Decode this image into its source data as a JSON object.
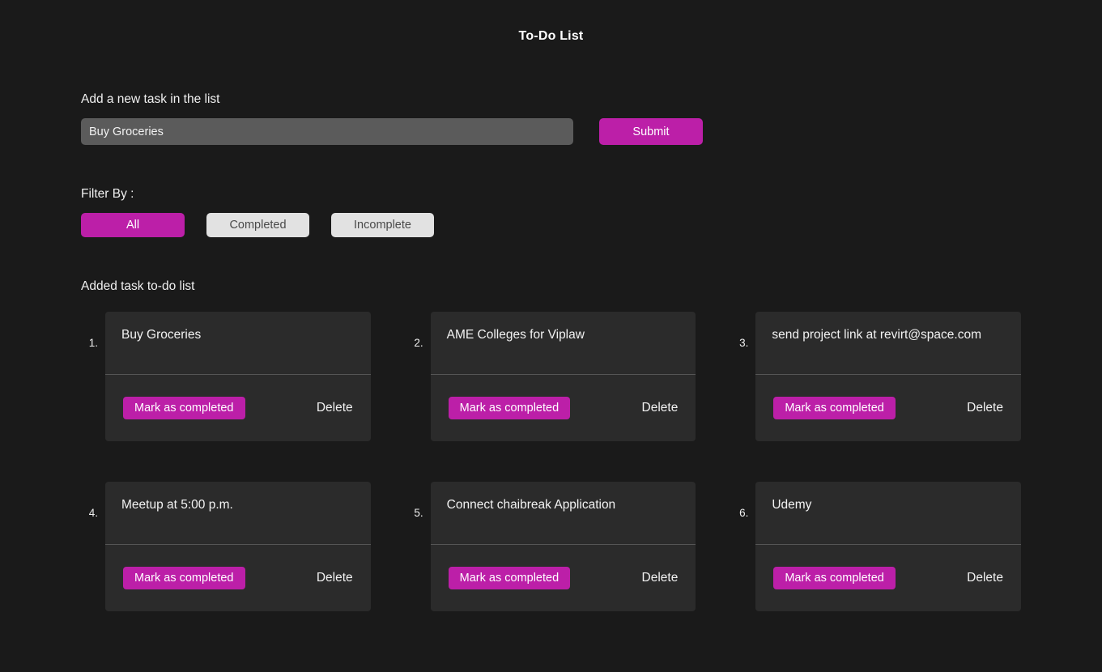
{
  "app": {
    "title": "To-Do List"
  },
  "add_task": {
    "label": "Add a new task in the list",
    "input_value": "Buy Groceries",
    "input_placeholder": "Add a new task in the list",
    "submit_label": "Submit"
  },
  "filter": {
    "label": "Filter By :",
    "options": [
      {
        "label": "All",
        "active": true
      },
      {
        "label": "Completed",
        "active": false
      },
      {
        "label": "Incomplete",
        "active": false
      }
    ]
  },
  "list": {
    "heading": "Added task to-do list",
    "complete_label": "Mark as completed",
    "delete_label": "Delete",
    "tasks": [
      {
        "index": "1.",
        "title": "Buy Groceries",
        "complete_label": "Mark as completed",
        "delete_label": "Delete"
      },
      {
        "index": "2.",
        "title": "AME Colleges for Viplaw",
        "complete_label": "Mark as completed",
        "delete_label": "Delete"
      },
      {
        "index": "3.",
        "title": "send project link at revirt@space.com",
        "complete_label": "Mark as completed",
        "delete_label": "Delete"
      },
      {
        "index": "4.",
        "title": "Meetup at 5:00 p.m.",
        "complete_label": "Mark as completed",
        "delete_label": "Delete"
      },
      {
        "index": "5.",
        "title": "Connect chaibreak Application",
        "complete_label": "Mark as completed",
        "delete_label": "Delete"
      },
      {
        "index": "6.",
        "title": "Udemy",
        "complete_label": "Mark as completed",
        "delete_label": "Delete"
      }
    ]
  },
  "colors": {
    "page_background": "#1a1a1a",
    "card_background": "#2b2b2b",
    "accent": "#bc1fa8",
    "input_background": "#5b5b5b",
    "filter_inactive_background": "#e2e2e2",
    "divider": "#555555",
    "text": "#f2f2f2"
  }
}
